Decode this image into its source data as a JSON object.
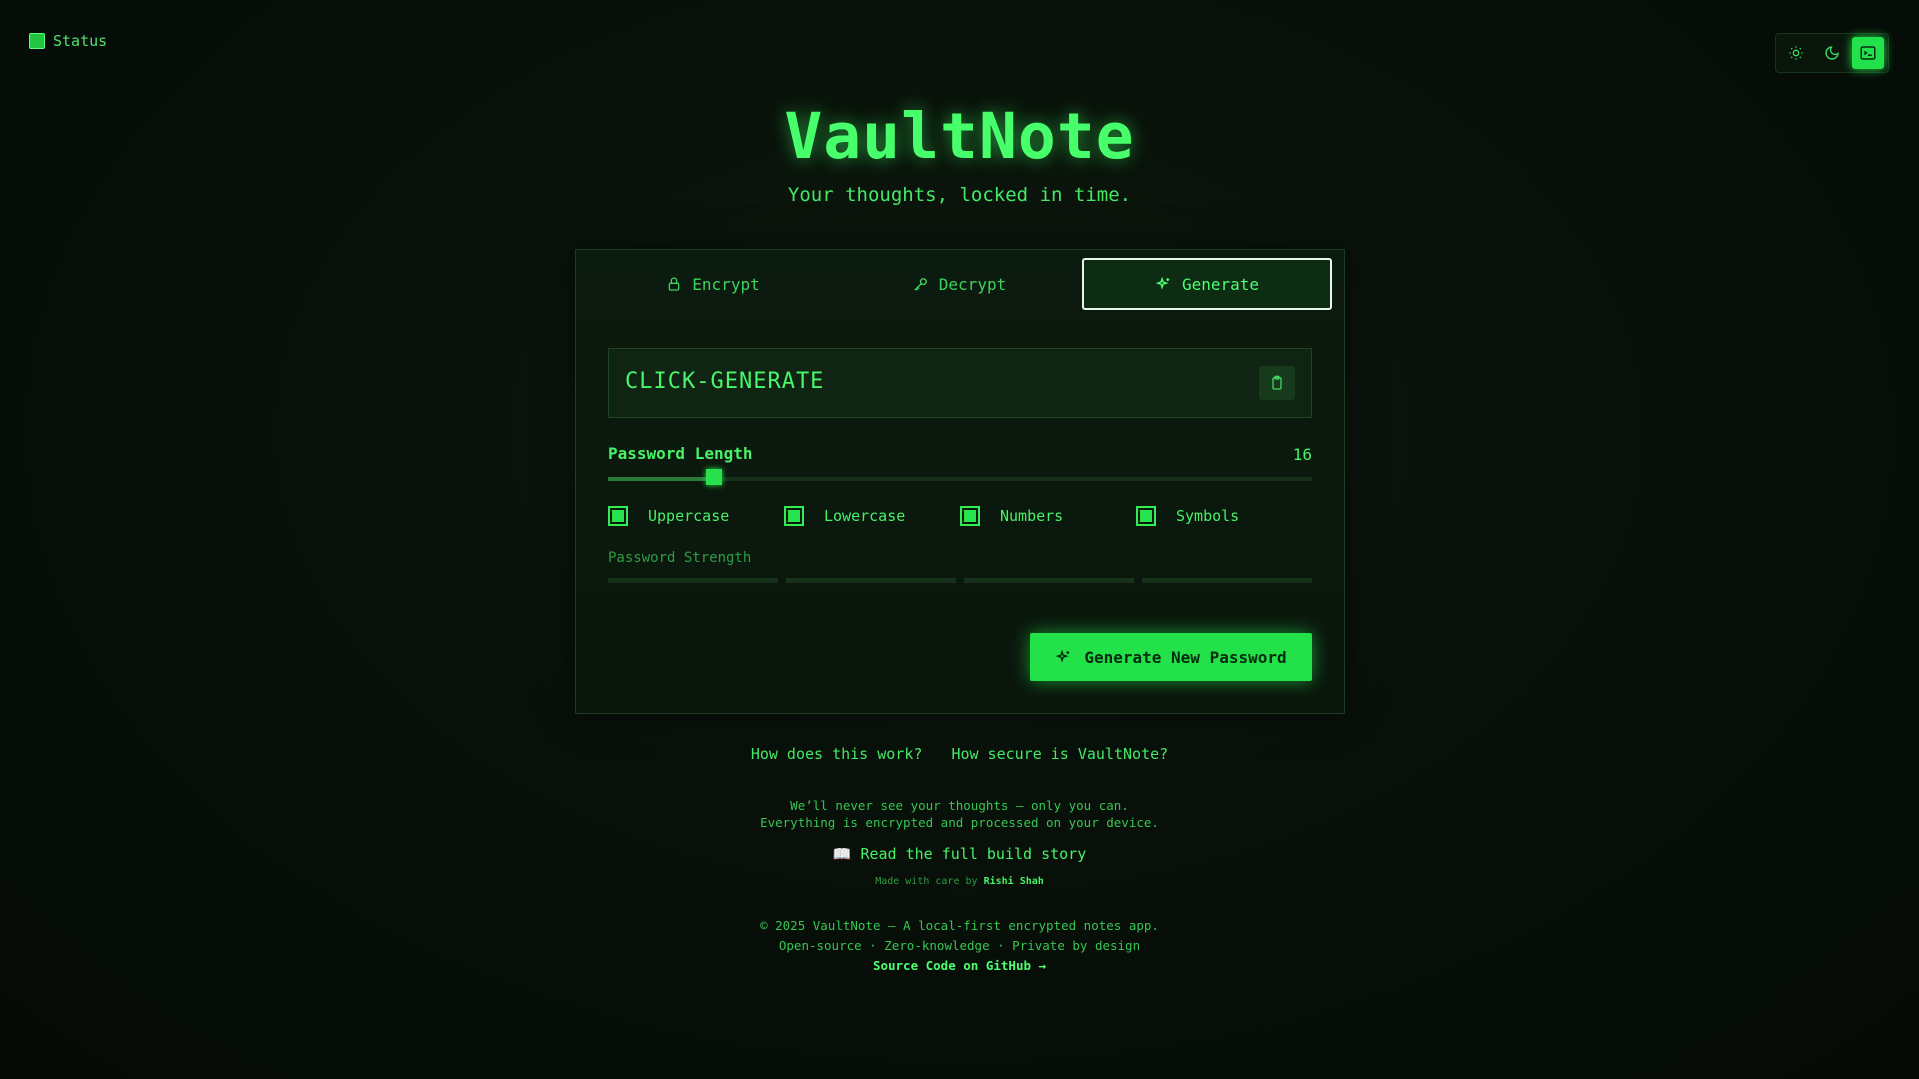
{
  "status": {
    "label": "Status"
  },
  "theme": {
    "options": [
      "light",
      "dark",
      "terminal"
    ],
    "active": "terminal"
  },
  "app": {
    "title": "VaultNote",
    "subtitle": "Your thoughts, locked in time."
  },
  "tabs": [
    {
      "label": "Encrypt",
      "icon": "lock-icon"
    },
    {
      "label": "Decrypt",
      "icon": "key-icon"
    },
    {
      "label": "Generate",
      "icon": "sparkles-icon",
      "active": true
    }
  ],
  "generator": {
    "password": "CLICK-GENERATE",
    "length_label": "Password Length",
    "length_value": "16",
    "length_fraction": 0.15,
    "options": [
      {
        "label": "Uppercase",
        "checked": true
      },
      {
        "label": "Lowercase",
        "checked": true
      },
      {
        "label": "Numbers",
        "checked": true
      },
      {
        "label": "Symbols",
        "checked": true
      }
    ],
    "strength_label": "Password Strength",
    "generate_label": "Generate New Password"
  },
  "links": {
    "how_works": "How does this work?",
    "how_secure": "How secure is VaultNote?"
  },
  "privacy": {
    "line1": "We’ll never see your thoughts — only you can.",
    "line2": "Everything is encrypted and processed on your device."
  },
  "story": {
    "label": "Read the full build story"
  },
  "made": {
    "prefix": "Made with care by",
    "author": "Rishi Shah"
  },
  "footer": {
    "copyright": "© 2025 VaultNote — A local-first encrypted notes app.",
    "tagline": "Open-source · Zero-knowledge · Private by design",
    "github": "Source Code on GitHub →"
  },
  "colors": {
    "accent": "#22e149",
    "background": "#081009"
  }
}
